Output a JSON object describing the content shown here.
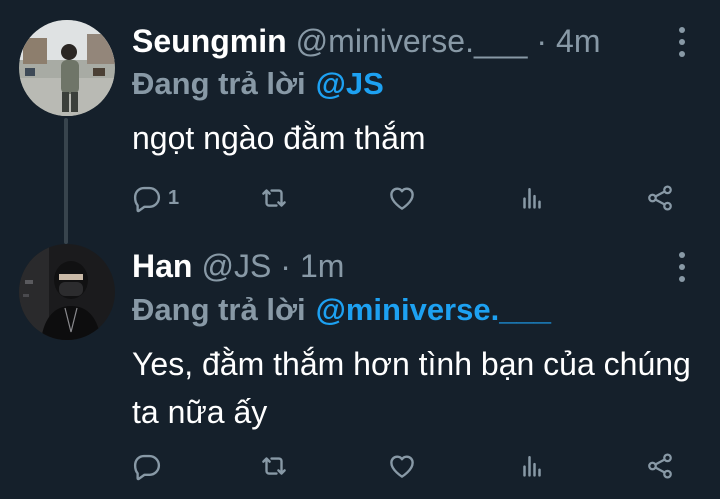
{
  "colors": {
    "background": "#15202b",
    "text_primary": "#ffffff",
    "text_secondary": "#8899a6",
    "accent": "#1da1f2",
    "thread_line": "#38444d"
  },
  "tweets": [
    {
      "display_name": "Seungmin",
      "handle": "@miniverse.___",
      "separator": "·",
      "time": "4m",
      "reply_prefix": "Đang trả lời",
      "reply_target": "@JS",
      "text": "ngọt ngào đằm thắm",
      "reply_count": "1",
      "icons": {
        "reply": "reply-icon",
        "retweet": "retweet-icon",
        "like": "heart-icon",
        "stats": "analytics-icon",
        "share": "share-icon",
        "more": "more-vertical-icon"
      }
    },
    {
      "display_name": "Han",
      "handle": "@JS",
      "separator": "·",
      "time": "1m",
      "reply_prefix": "Đang trả lời",
      "reply_target": "@miniverse.___",
      "text": "Yes, đằm thắm hơn tình bạn của chúng ta nữa ấy",
      "reply_count": "",
      "icons": {
        "reply": "reply-icon",
        "retweet": "retweet-icon",
        "like": "heart-icon",
        "stats": "analytics-icon",
        "share": "share-icon",
        "more": "more-vertical-icon"
      }
    }
  ]
}
